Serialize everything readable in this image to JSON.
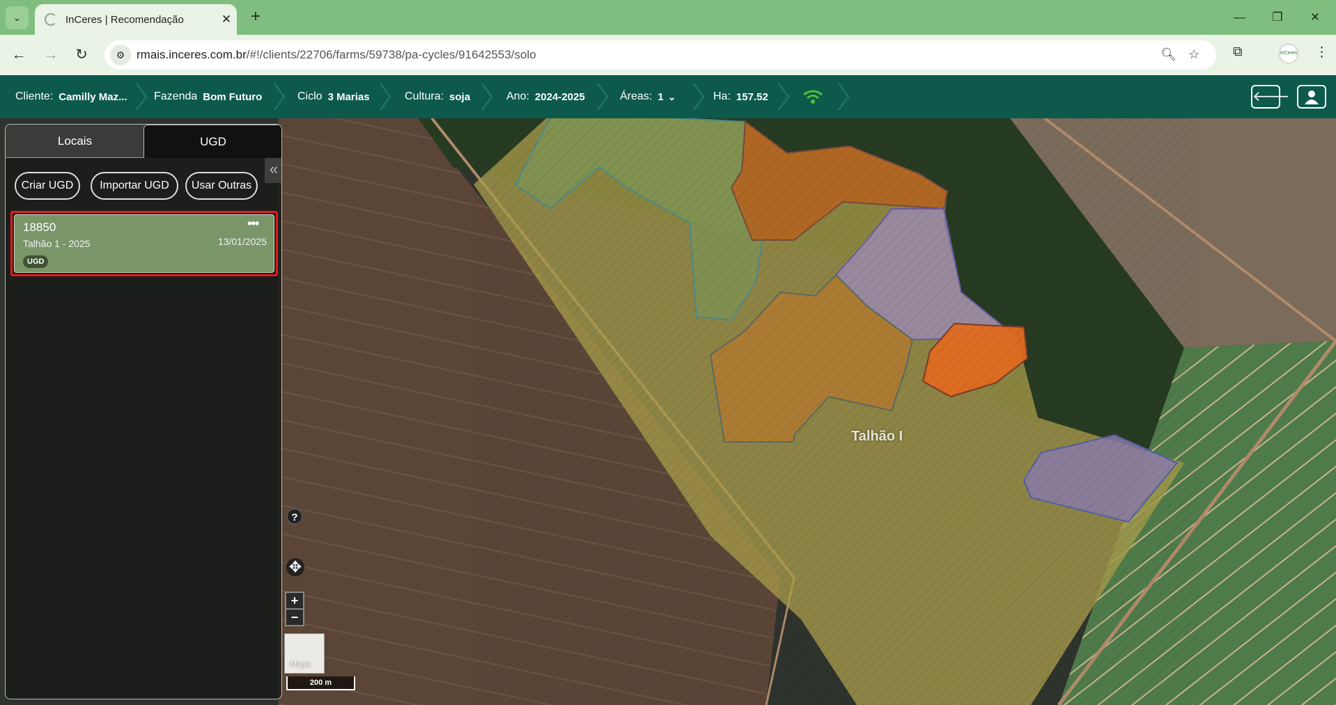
{
  "browser": {
    "tab_title": "InCeres | Recomendação",
    "tab_close": "✕",
    "new_tab": "+",
    "url_host": "rmais.inceres.com.br",
    "url_path": "/#!/clients/22706/farms/59738/pa-cycles/91642553/solo",
    "profile_text": "InCeres"
  },
  "header": {
    "crumbs": [
      {
        "label": "Cliente:",
        "value": "Camilly Maz..."
      },
      {
        "label": "Fazenda",
        "value": "Bom Futuro"
      },
      {
        "label": "Ciclo",
        "value": "3 Marias"
      },
      {
        "label": "Cultura:",
        "value": "soja"
      },
      {
        "label": "Ano:",
        "value": "2024-2025"
      },
      {
        "label": "Áreas:",
        "value": "1"
      },
      {
        "label": "Ha:",
        "value": "157.52"
      }
    ],
    "status_color": "#4cc23a"
  },
  "panel": {
    "tabs": [
      "Locais",
      "UGD"
    ],
    "buttons": [
      "Criar UGD",
      "Importar UGD",
      "Usar Outras"
    ],
    "card": {
      "id": "18850",
      "subtitle": "Talhão 1 - 2025",
      "date": "13/01/2025",
      "badge": "UGD",
      "menu": "•••"
    }
  },
  "map": {
    "field_label": "Talhão I",
    "help": "?",
    "zoom_in": "+",
    "zoom_out": "−",
    "layer_label": "Mapa",
    "scale_label": "200 m"
  }
}
